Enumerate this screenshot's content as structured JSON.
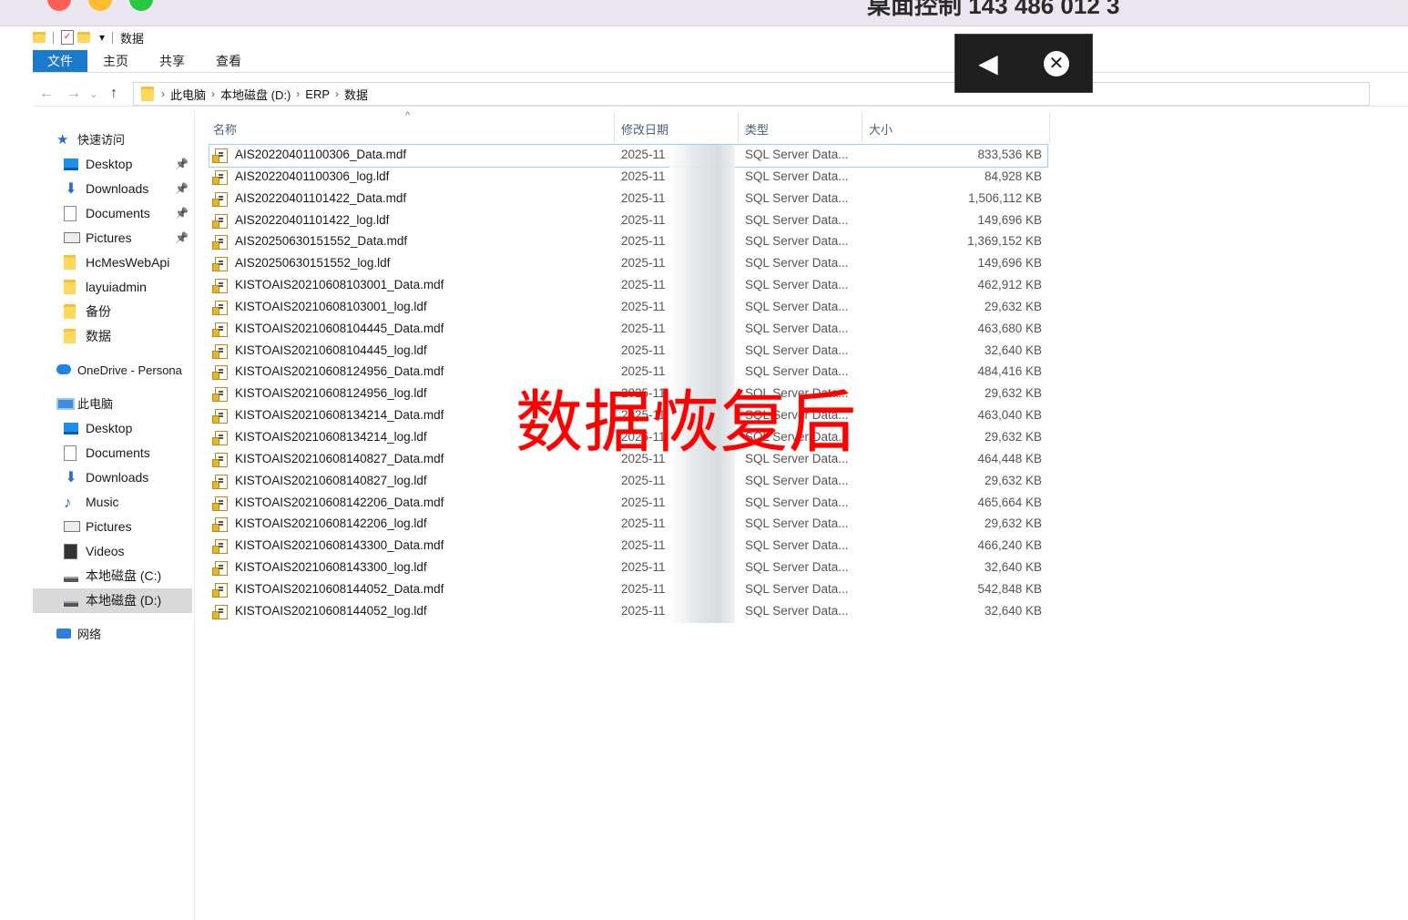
{
  "mac_window": {
    "title": "桌面控制 143 486 012 3"
  },
  "quick_access_toolbar": {
    "dropdown_glyph": "▾",
    "title": "数据"
  },
  "ribbon": {
    "tabs": [
      "文件",
      "主页",
      "共享",
      "查看"
    ]
  },
  "address_bar": {
    "crumbs": [
      "此电脑",
      "本地磁盘 (D:)",
      "ERP",
      "数据"
    ]
  },
  "remote_toolbar": {
    "icons": [
      "collapse-icon",
      "close-icon"
    ]
  },
  "sidebar": {
    "quick_access": {
      "label": "快速访问",
      "icon": "star-icon"
    },
    "quick_items": [
      {
        "label": "Desktop",
        "icon": "desktop-icon",
        "pinned": true
      },
      {
        "label": "Downloads",
        "icon": "download-icon",
        "pinned": true
      },
      {
        "label": "Documents",
        "icon": "document-icon",
        "pinned": true
      },
      {
        "label": "Pictures",
        "icon": "pictures-icon",
        "pinned": true
      },
      {
        "label": "HcMesWebApi",
        "icon": "folder-icon",
        "pinned": false
      },
      {
        "label": "layuiadmin",
        "icon": "folder-icon",
        "pinned": false
      },
      {
        "label": "备份",
        "icon": "folder-icon",
        "pinned": false
      },
      {
        "label": "数据",
        "icon": "folder-icon",
        "pinned": false
      }
    ],
    "onedrive": {
      "label": "OneDrive - Persona",
      "icon": "cloud-icon"
    },
    "this_pc": {
      "label": "此电脑",
      "icon": "computer-icon"
    },
    "pc_items": [
      {
        "label": "Desktop",
        "icon": "desktop-icon"
      },
      {
        "label": "Documents",
        "icon": "document-icon"
      },
      {
        "label": "Downloads",
        "icon": "download-icon"
      },
      {
        "label": "Music",
        "icon": "music-icon"
      },
      {
        "label": "Pictures",
        "icon": "pictures-icon"
      },
      {
        "label": "Videos",
        "icon": "video-icon"
      },
      {
        "label": "本地磁盘 (C:)",
        "icon": "drive-icon"
      },
      {
        "label": "本地磁盘 (D:)",
        "icon": "drive-icon",
        "selected": true
      }
    ],
    "network": {
      "label": "网络",
      "icon": "network-icon"
    }
  },
  "file_list": {
    "columns": {
      "name": "名称",
      "modified": "修改日期",
      "type": "类型",
      "size": "大小"
    },
    "sort_glyph": "^",
    "rows": [
      {
        "name": "AIS20220401100306_Data.mdf",
        "date": "2025-11",
        "type": "SQL Server Data...",
        "size": "833,536 KB"
      },
      {
        "name": "AIS20220401100306_log.ldf",
        "date": "2025-11",
        "type": "SQL Server Data...",
        "size": "84,928 KB"
      },
      {
        "name": "AIS20220401101422_Data.mdf",
        "date": "2025-11",
        "type": "SQL Server Data...",
        "size": "1,506,112 KB"
      },
      {
        "name": "AIS20220401101422_log.ldf",
        "date": "2025-11",
        "type": "SQL Server Data...",
        "size": "149,696 KB"
      },
      {
        "name": "AIS20250630151552_Data.mdf",
        "date": "2025-11",
        "type": "SQL Server Data...",
        "size": "1,369,152 KB"
      },
      {
        "name": "AIS20250630151552_log.ldf",
        "date": "2025-11",
        "type": "SQL Server Data...",
        "size": "149,696 KB"
      },
      {
        "name": "KISTOAIS20210608103001_Data.mdf",
        "date": "2025-11",
        "type": "SQL Server Data...",
        "size": "462,912 KB"
      },
      {
        "name": "KISTOAIS20210608103001_log.ldf",
        "date": "2025-11",
        "type": "SQL Server Data...",
        "size": "29,632 KB"
      },
      {
        "name": "KISTOAIS20210608104445_Data.mdf",
        "date": "2025-11",
        "type": "SQL Server Data...",
        "size": "463,680 KB"
      },
      {
        "name": "KISTOAIS20210608104445_log.ldf",
        "date": "2025-11",
        "type": "SQL Server Data...",
        "size": "32,640 KB"
      },
      {
        "name": "KISTOAIS20210608124956_Data.mdf",
        "date": "2025-11",
        "type": "SQL Server Data...",
        "size": "484,416 KB"
      },
      {
        "name": "KISTOAIS20210608124956_log.ldf",
        "date": "2025-11",
        "type": "SQL Server Data...",
        "size": "29,632 KB"
      },
      {
        "name": "KISTOAIS20210608134214_Data.mdf",
        "date": "2025-11",
        "type": "SQL Server Data...",
        "size": "463,040 KB"
      },
      {
        "name": "KISTOAIS20210608134214_log.ldf",
        "date": "2025-11",
        "type": "SQL Server Data...",
        "size": "29,632 KB"
      },
      {
        "name": "KISTOAIS20210608140827_Data.mdf",
        "date": "2025-11",
        "type": "SQL Server Data...",
        "size": "464,448 KB"
      },
      {
        "name": "KISTOAIS20210608140827_log.ldf",
        "date": "2025-11",
        "type": "SQL Server Data...",
        "size": "29,632 KB"
      },
      {
        "name": "KISTOAIS20210608142206_Data.mdf",
        "date": "2025-11",
        "type": "SQL Server Data...",
        "size": "465,664 KB"
      },
      {
        "name": "KISTOAIS20210608142206_log.ldf",
        "date": "2025-11",
        "type": "SQL Server Data...",
        "size": "29,632 KB"
      },
      {
        "name": "KISTOAIS20210608143300_Data.mdf",
        "date": "2025-11",
        "type": "SQL Server Data...",
        "size": "466,240 KB"
      },
      {
        "name": "KISTOAIS20210608143300_log.ldf",
        "date": "2025-11",
        "type": "SQL Server Data...",
        "size": "32,640 KB"
      },
      {
        "name": "KISTOAIS20210608144052_Data.mdf",
        "date": "2025-11",
        "type": "SQL Server Data...",
        "size": "542,848 KB"
      },
      {
        "name": "KISTOAIS20210608144052_log.ldf",
        "date": "2025-11",
        "type": "SQL Server Data...",
        "size": "32,640 KB"
      }
    ]
  },
  "overlay_stamp": {
    "text": "数据恢复后",
    "color": "#ff0000"
  },
  "colors": {
    "ribbon_file_tab": "#1979ca",
    "selected_nav": "#d9d9d9",
    "selected_row_border": "#99d1ff"
  }
}
